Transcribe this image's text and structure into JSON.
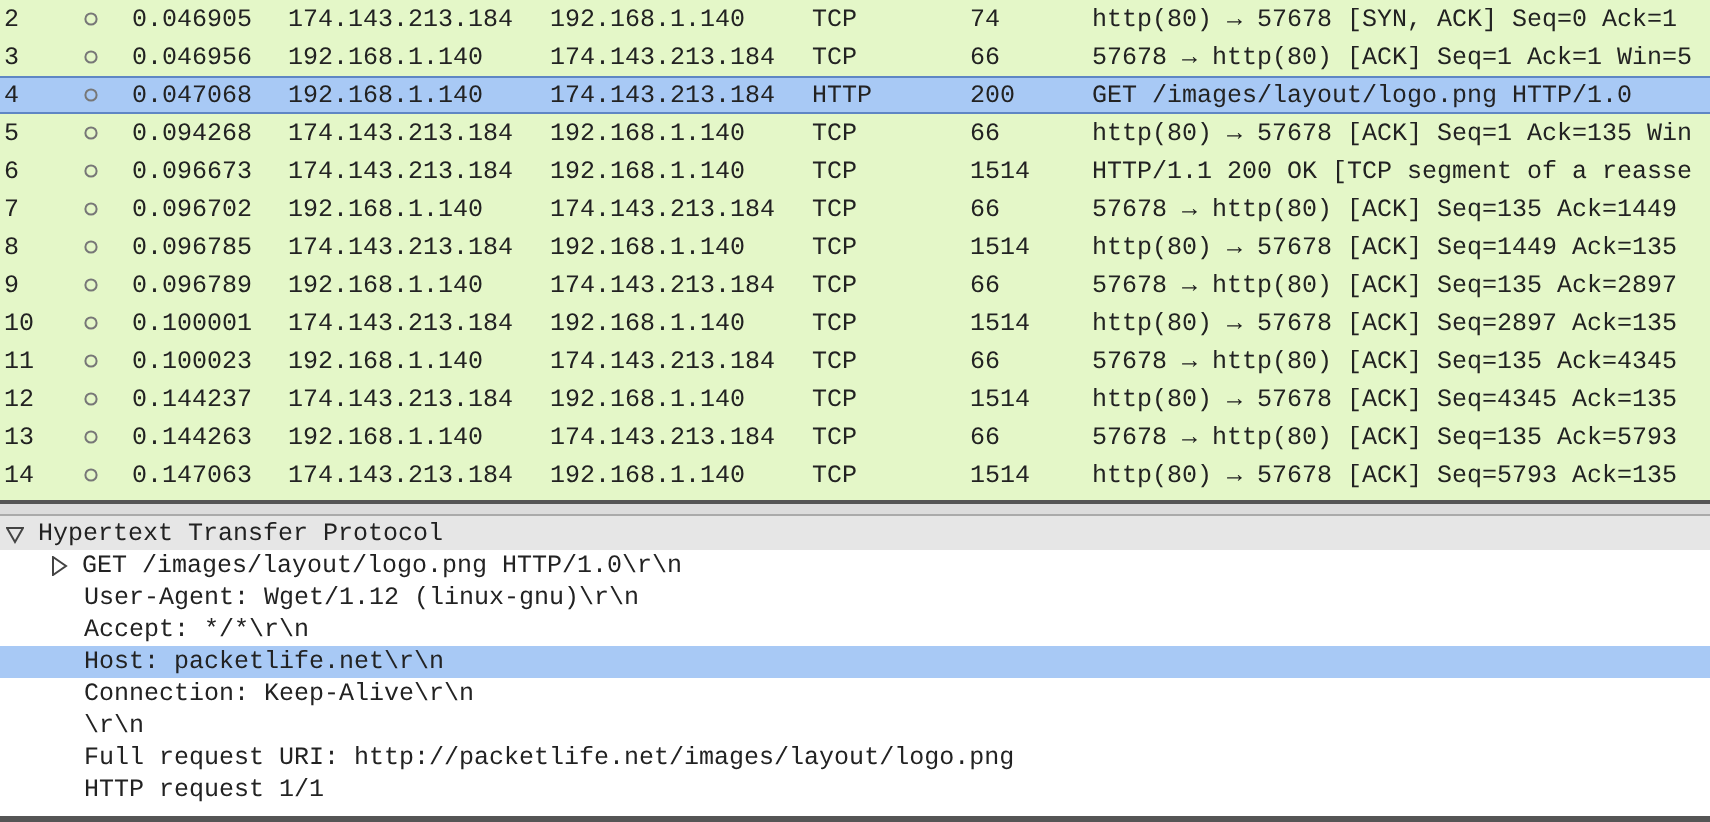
{
  "packet_list": {
    "rows": [
      {
        "no": "2",
        "time": "0.046905",
        "source": "174.143.213.184",
        "destination": "192.168.1.140",
        "protocol": "TCP",
        "length": "74",
        "info": "http(80) → 57678 [SYN, ACK] Seq=0 Ack=1",
        "selected": false
      },
      {
        "no": "3",
        "time": "0.046956",
        "source": "192.168.1.140",
        "destination": "174.143.213.184",
        "protocol": "TCP",
        "length": "66",
        "info": "57678 → http(80) [ACK] Seq=1 Ack=1 Win=5",
        "selected": false
      },
      {
        "no": "4",
        "time": "0.047068",
        "source": "192.168.1.140",
        "destination": "174.143.213.184",
        "protocol": "HTTP",
        "length": "200",
        "info": "GET /images/layout/logo.png HTTP/1.0",
        "selected": true
      },
      {
        "no": "5",
        "time": "0.094268",
        "source": "174.143.213.184",
        "destination": "192.168.1.140",
        "protocol": "TCP",
        "length": "66",
        "info": "http(80) → 57678 [ACK] Seq=1 Ack=135 Win",
        "selected": false
      },
      {
        "no": "6",
        "time": "0.096673",
        "source": "174.143.213.184",
        "destination": "192.168.1.140",
        "protocol": "TCP",
        "length": "1514",
        "info": "HTTP/1.1 200 OK [TCP segment of a reasse",
        "selected": false
      },
      {
        "no": "7",
        "time": "0.096702",
        "source": "192.168.1.140",
        "destination": "174.143.213.184",
        "protocol": "TCP",
        "length": "66",
        "info": "57678 → http(80) [ACK] Seq=135 Ack=1449",
        "selected": false
      },
      {
        "no": "8",
        "time": "0.096785",
        "source": "174.143.213.184",
        "destination": "192.168.1.140",
        "protocol": "TCP",
        "length": "1514",
        "info": "http(80) → 57678 [ACK] Seq=1449 Ack=135",
        "selected": false
      },
      {
        "no": "9",
        "time": "0.096789",
        "source": "192.168.1.140",
        "destination": "174.143.213.184",
        "protocol": "TCP",
        "length": "66",
        "info": "57678 → http(80) [ACK] Seq=135 Ack=2897",
        "selected": false
      },
      {
        "no": "10",
        "time": "0.100001",
        "source": "174.143.213.184",
        "destination": "192.168.1.140",
        "protocol": "TCP",
        "length": "1514",
        "info": "http(80) → 57678 [ACK] Seq=2897 Ack=135",
        "selected": false
      },
      {
        "no": "11",
        "time": "0.100023",
        "source": "192.168.1.140",
        "destination": "174.143.213.184",
        "protocol": "TCP",
        "length": "66",
        "info": "57678 → http(80) [ACK] Seq=135 Ack=4345",
        "selected": false
      },
      {
        "no": "12",
        "time": "0.144237",
        "source": "174.143.213.184",
        "destination": "192.168.1.140",
        "protocol": "TCP",
        "length": "1514",
        "info": "http(80) → 57678 [ACK] Seq=4345 Ack=135",
        "selected": false
      },
      {
        "no": "13",
        "time": "0.144263",
        "source": "192.168.1.140",
        "destination": "174.143.213.184",
        "protocol": "TCP",
        "length": "66",
        "info": "57678 → http(80) [ACK] Seq=135 Ack=5793",
        "selected": false
      },
      {
        "no": "14",
        "time": "0.147063",
        "source": "174.143.213.184",
        "destination": "192.168.1.140",
        "protocol": "TCP",
        "length": "1514",
        "info": "http(80) → 57678 [ACK] Seq=5793 Ack=135",
        "selected": false
      }
    ]
  },
  "packet_details": {
    "label": "Hypertext Transfer Protocol",
    "expanded": true,
    "children": [
      {
        "kind": "group",
        "label": "GET /images/layout/logo.png HTTP/1.0\\r\\n",
        "expanded": false,
        "selected": false
      },
      {
        "kind": "field",
        "label": "User-Agent: Wget/1.12 (linux-gnu)\\r\\n",
        "selected": false
      },
      {
        "kind": "field",
        "label": "Accept: */*\\r\\n",
        "selected": false
      },
      {
        "kind": "field",
        "label": "Host: packetlife.net\\r\\n",
        "selected": true
      },
      {
        "kind": "field",
        "label": "Connection: Keep-Alive\\r\\n",
        "selected": false
      },
      {
        "kind": "field",
        "label": "\\r\\n",
        "selected": false
      },
      {
        "kind": "field",
        "label": "Full request URI: http://packetlife.net/images/layout/logo.png",
        "selected": false
      },
      {
        "kind": "field",
        "label": "HTTP request 1/1",
        "selected": false
      }
    ]
  }
}
